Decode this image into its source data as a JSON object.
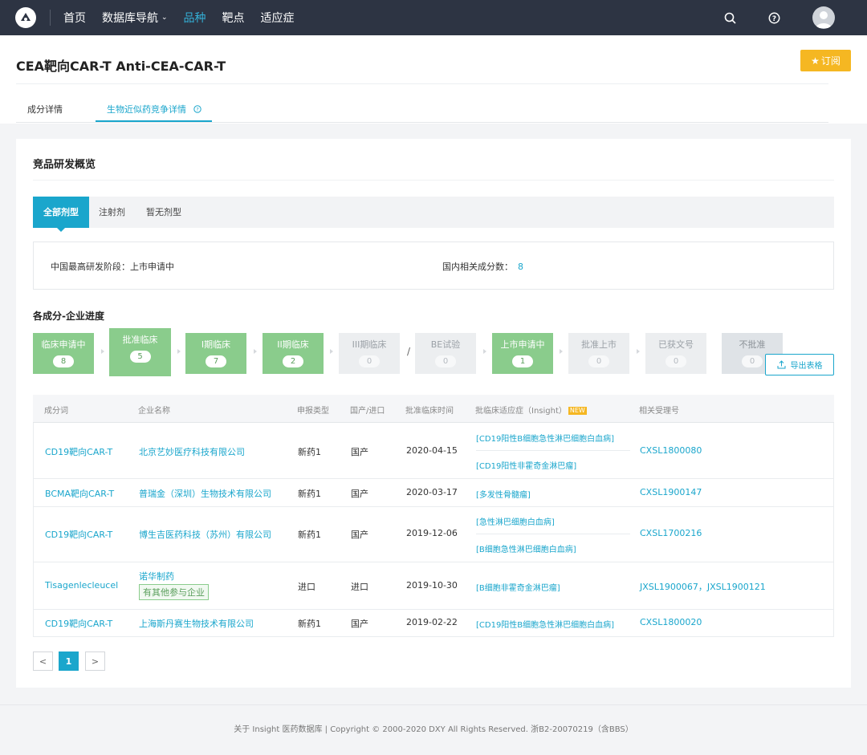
{
  "nav": {
    "items": [
      "首页",
      "数据库导航",
      "品种",
      "靶点",
      "适应症"
    ],
    "active_index": 2,
    "accent": "#34b0d7"
  },
  "header": {
    "title": "CEA靶向CAR-T Anti-CEA-CAR-T",
    "subscribe": "订阅",
    "tabs": [
      "成分详情",
      "生物近似药竞争详情"
    ],
    "active_tab": 1
  },
  "overview": {
    "title": "竞品研发概览",
    "dosage_tabs": [
      "全部剂型",
      "注射剂",
      "暂无剂型"
    ],
    "china_stage_label": "中国最高研发阶段：",
    "china_stage_value": "上市申请中",
    "domestic_count_label": "国内相关成分数：",
    "domestic_count_value": "8"
  },
  "progress": {
    "title": "各成分-企业进度",
    "stages": [
      {
        "label": "临床申请中",
        "count": "8"
      },
      {
        "label": "批准临床",
        "count": "5"
      },
      {
        "label": "I期临床",
        "count": "7"
      },
      {
        "label": "II期临床",
        "count": "2"
      },
      {
        "label": "III期临床",
        "count": "0"
      },
      {
        "label": "BE试验",
        "count": "0"
      },
      {
        "label": "上市申请中",
        "count": "1"
      },
      {
        "label": "批准上市",
        "count": "0"
      },
      {
        "label": "已获文号",
        "count": "0"
      },
      {
        "label": "不批准",
        "count": "0"
      }
    ],
    "slash": "/",
    "export": "导出表格"
  },
  "table": {
    "headers": [
      "成分词",
      "企业名称",
      "申报类型",
      "国产/进口",
      "批准临床时间",
      "批临床适应症（Insight）",
      "相关受理号"
    ],
    "new_badge": "NEW",
    "rows": [
      {
        "ingredient": "CD19靶向CAR-T",
        "company": "北京艺妙医疗科技有限公司",
        "type": "新药1",
        "origin": "国产",
        "date": "2020-04-15",
        "indications": [
          "[CD19阳性B细胞急性淋巴细胞白血病]",
          "[CD19阳性非霍奇金淋巴瘤]"
        ],
        "accept_no": "CXSL1800080"
      },
      {
        "ingredient": "BCMA靶向CAR-T",
        "company": "普瑞金（深圳）生物技术有限公司",
        "type": "新药1",
        "origin": "国产",
        "date": "2020-03-17",
        "indications": [
          "[多发性骨髓瘤]"
        ],
        "accept_no": "CXSL1900147"
      },
      {
        "ingredient": "CD19靶向CAR-T",
        "company": "博生吉医药科技（苏州）有限公司",
        "type": "新药1",
        "origin": "国产",
        "date": "2019-12-06",
        "indications": [
          "[急性淋巴细胞白血病]",
          "[B细胞急性淋巴细胞白血病]"
        ],
        "accept_no": "CXSL1700216"
      },
      {
        "ingredient": "Tisagenlecleucel",
        "company": "诺华制药",
        "company_extra": "有其他参与企业",
        "type": "进口",
        "origin": "进口",
        "date": "2019-10-30",
        "indications": [
          "[B细胞非霍奇金淋巴瘤]"
        ],
        "accept_no": "JXSL1900067，JXSL1900121"
      },
      {
        "ingredient": "CD19靶向CAR-T",
        "company": "上海斯丹赛生物技术有限公司",
        "type": "新药1",
        "origin": "国产",
        "date": "2019-02-22",
        "indications": [
          "[CD19阳性B细胞急性淋巴细胞白血病]"
        ],
        "accept_no": "CXSL1800020"
      }
    ]
  },
  "pagination": {
    "prev": "<",
    "current": "1",
    "next": ">"
  },
  "footer": {
    "text": "关于 Insight 医药数据库 | Copyright © 2000-2020 DXY All Rights Reserved. 浙B2-20070219（含BBS）"
  }
}
